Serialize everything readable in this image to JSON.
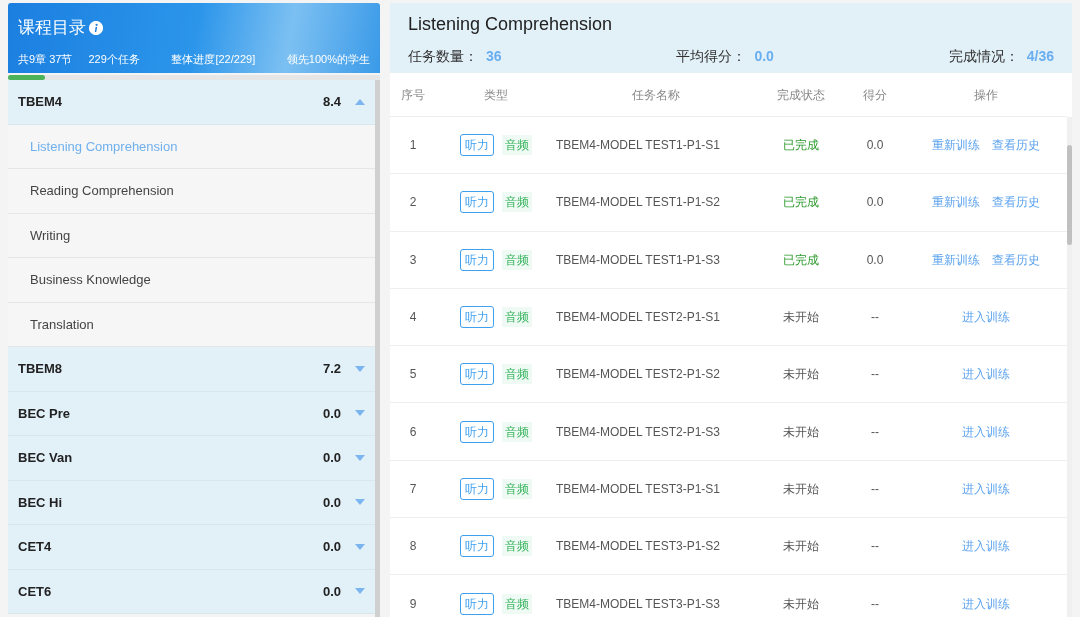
{
  "sidebar": {
    "title": "课程目录",
    "summary": [
      "共9章 37节",
      "229个任务",
      "整体进度[22/229]",
      "领先100%的学生"
    ],
    "progress": {
      "level": 0.1
    },
    "chapters": [
      {
        "name": "TBEM4",
        "score": "8.4",
        "expanded": true,
        "children": [
          {
            "label": "Listening Comprehension",
            "selected": true
          },
          {
            "label": "Reading Comprehension",
            "selected": false
          },
          {
            "label": "Writing",
            "selected": false
          },
          {
            "label": "Business Knowledge",
            "selected": false
          },
          {
            "label": "Translation",
            "selected": false
          }
        ]
      },
      {
        "name": "TBEM8",
        "score": "7.2",
        "expanded": false
      },
      {
        "name": "BEC Pre",
        "score": "0.0",
        "expanded": false
      },
      {
        "name": "BEC Van",
        "score": "0.0",
        "expanded": false
      },
      {
        "name": "BEC Hi",
        "score": "0.0",
        "expanded": false
      },
      {
        "name": "CET4",
        "score": "0.0",
        "expanded": false
      },
      {
        "name": "CET6",
        "score": "0.0",
        "expanded": false
      }
    ]
  },
  "main": {
    "title": "Listening Comprehension",
    "stats": [
      {
        "label": "任务数量：",
        "value": "36"
      },
      {
        "label": "平均得分：",
        "value": "0.0"
      },
      {
        "label": "完成情况：",
        "value": "4/36"
      }
    ],
    "table": {
      "columns": [
        "序号",
        "类型",
        "任务名称",
        "完成状态",
        "得分",
        "操作"
      ],
      "rows": [
        {
          "index": "1",
          "tags": [
            "听力",
            "音频"
          ],
          "name": "TBEM4-MODEL TEST1-P1-S1",
          "status": "已完成",
          "completed": true,
          "score": "0.0",
          "actions": [
            "重新训练",
            "查看历史"
          ]
        },
        {
          "index": "2",
          "tags": [
            "听力",
            "音频"
          ],
          "name": "TBEM4-MODEL TEST1-P1-S2",
          "status": "已完成",
          "completed": true,
          "score": "0.0",
          "actions": [
            "重新训练",
            "查看历史"
          ]
        },
        {
          "index": "3",
          "tags": [
            "听力",
            "音频"
          ],
          "name": "TBEM4-MODEL TEST1-P1-S3",
          "status": "已完成",
          "completed": true,
          "score": "0.0",
          "actions": [
            "重新训练",
            "查看历史"
          ]
        },
        {
          "index": "4",
          "tags": [
            "听力",
            "音频"
          ],
          "name": "TBEM4-MODEL TEST2-P1-S1",
          "status": "未开始",
          "completed": false,
          "score": "--",
          "actions": [
            "进入训练"
          ]
        },
        {
          "index": "5",
          "tags": [
            "听力",
            "音频"
          ],
          "name": "TBEM4-MODEL TEST2-P1-S2",
          "status": "未开始",
          "completed": false,
          "score": "--",
          "actions": [
            "进入训练"
          ]
        },
        {
          "index": "6",
          "tags": [
            "听力",
            "音频"
          ],
          "name": "TBEM4-MODEL TEST2-P1-S3",
          "status": "未开始",
          "completed": false,
          "score": "--",
          "actions": [
            "进入训练"
          ]
        },
        {
          "index": "7",
          "tags": [
            "听力",
            "音频"
          ],
          "name": "TBEM4-MODEL TEST3-P1-S1",
          "status": "未开始",
          "completed": false,
          "score": "--",
          "actions": [
            "进入训练"
          ]
        },
        {
          "index": "8",
          "tags": [
            "听力",
            "音频"
          ],
          "name": "TBEM4-MODEL TEST3-P1-S2",
          "status": "未开始",
          "completed": false,
          "score": "--",
          "actions": [
            "进入训练"
          ]
        },
        {
          "index": "9",
          "tags": [
            "听力",
            "音频"
          ],
          "name": "TBEM4-MODEL TEST3-P1-S3",
          "status": "未开始",
          "completed": false,
          "score": "--",
          "actions": [
            "进入训练"
          ]
        }
      ]
    }
  }
}
